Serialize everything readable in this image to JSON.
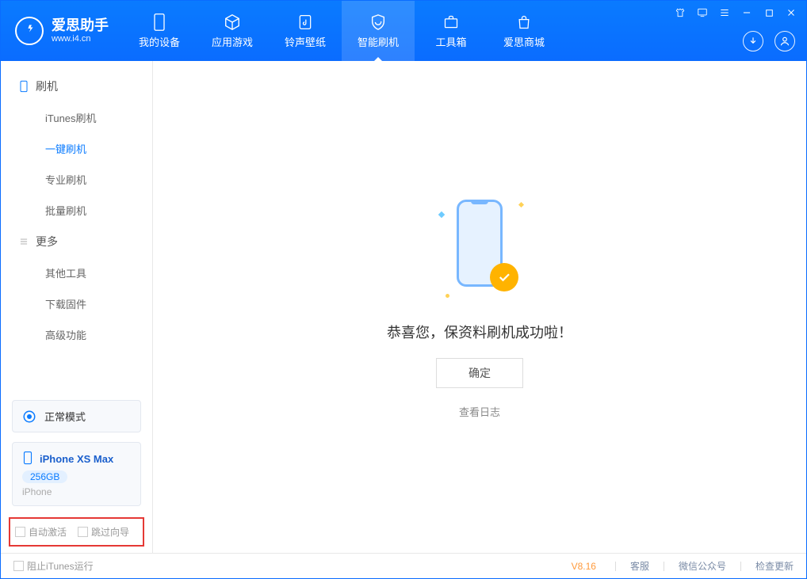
{
  "app": {
    "title": "爱思助手",
    "url": "www.i4.cn"
  },
  "nav": {
    "items": [
      {
        "label": "我的设备"
      },
      {
        "label": "应用游戏"
      },
      {
        "label": "铃声壁纸"
      },
      {
        "label": "智能刷机"
      },
      {
        "label": "工具箱"
      },
      {
        "label": "爱思商城"
      }
    ],
    "active_index": 3
  },
  "sidebar": {
    "groups": [
      {
        "title": "刷机",
        "items": [
          {
            "label": "iTunes刷机"
          },
          {
            "label": "一键刷机"
          },
          {
            "label": "专业刷机"
          },
          {
            "label": "批量刷机"
          }
        ],
        "active_index": 1
      },
      {
        "title": "更多",
        "items": [
          {
            "label": "其他工具"
          },
          {
            "label": "下载固件"
          },
          {
            "label": "高级功能"
          }
        ],
        "active_index": -1
      }
    ],
    "mode": {
      "label": "正常模式"
    },
    "device": {
      "name": "iPhone XS Max",
      "capacity": "256GB",
      "type": "iPhone"
    },
    "options": {
      "auto_activate": "自动激活",
      "skip_guide": "跳过向导"
    }
  },
  "main": {
    "success": "恭喜您，保资料刷机成功啦！",
    "ok": "确定",
    "log": "查看日志"
  },
  "footer": {
    "block_itunes": "阻止iTunes运行",
    "version": "V8.16",
    "support": "客服",
    "wechat": "微信公众号",
    "update": "检查更新"
  }
}
